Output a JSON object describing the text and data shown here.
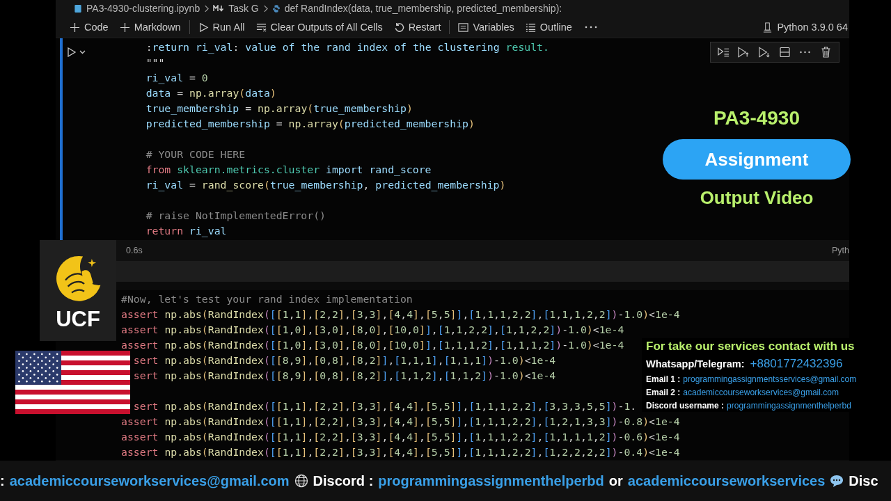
{
  "breadcrumb": [
    {
      "kind": "notebook",
      "text": "PA3-4930-clustering.ipynb"
    },
    {
      "kind": "markdown",
      "text": "Task G"
    },
    {
      "kind": "python",
      "text": "def RandIndex(data, true_membership, predicted_membership):"
    }
  ],
  "toolbar": [
    {
      "kind": "plus",
      "label": "Code"
    },
    {
      "kind": "plus",
      "label": "Markdown"
    },
    {
      "kind": "run",
      "label": "Run All"
    },
    {
      "kind": "clear",
      "label": "Clear Outputs of All Cells"
    },
    {
      "kind": "restart",
      "label": "Restart"
    },
    {
      "kind": "variables",
      "label": "Variables"
    },
    {
      "kind": "outline",
      "label": "Outline"
    }
  ],
  "kernel": "Python 3.9.0 64",
  "cells": [
    {
      "selected": true,
      "time": "0.6s",
      "language": "Pyth",
      "blocks": [
        [
          "    :return ri_val: value of the rand index of the clustering result.",
          "    \"\"\"",
          "    ri_val = 0",
          "    data = np.array(data)",
          "    true_membership = np.array(true_membership)",
          "    predicted_membership = np.array(predicted_membership)"
        ],
        [
          "    # YOUR CODE HERE",
          "    from sklearn.metrics.cluster import rand_score",
          "    ri_val = rand_score(true_membership, predicted_membership)"
        ],
        [
          "    # raise NotImplementedError()",
          "    return ri_val"
        ]
      ]
    },
    {
      "selected": false,
      "blocks": [
        [
          "#Now, let's test your rand index implementation",
          "assert np.abs(RandIndex([[1,1],[2,2],[3,3],[4,4],[5,5]],[1,1,1,2,2],[1,1,1,2,2])-1.0)<1e-4",
          "assert np.abs(RandIndex([[1,0],[3,0],[8,0],[10,0]],[1,1,2,2],[1,1,2,2])-1.0)<1e-4",
          "assert np.abs(RandIndex([[1,0],[3,0],[8,0],[10,0]],[1,1,1,2],[1,1,1,2])-1.0)<1e-4",
          "  sert np.abs(RandIndex([[8,9],[0,8],[8,2]],[1,1,1],[1,1,1])-1.0)<1e-4",
          "  sert np.abs(RandIndex([[8,9],[0,8],[8,2]],[1,1,2],[1,1,2])-1.0)<1e-4"
        ],
        [
          "  sert np.abs(RandIndex([[1,1],[2,2],[3,3],[4,4],[5,5]],[1,1,1,2,2],[3,3,3,5,5])-1.",
          "assert np.abs(RandIndex([[1,1],[2,2],[3,3],[4,4],[5,5]],[1,1,1,2,2],[1,2,1,3,3])-0.8)<1e-4",
          "assert np.abs(RandIndex([[1,1],[2,2],[3,3],[4,4],[5,5]],[1,1,1,2,2],[1,1,1,1,2])-0.6)<1e-4",
          "assert np.abs(RandIndex([[1,1],[2,2],[3,3],[4,4],[5,5]],[1,1,1,2,2],[1,2,2,2,2])-0.4)<1e-4"
        ]
      ]
    }
  ],
  "promo": {
    "title": "PA3-4930",
    "badge": "Assignment",
    "subtitle": "Output Video"
  },
  "logo": {
    "text": "UCF"
  },
  "contact": {
    "heading": "For  take our services contact with us",
    "rows": [
      {
        "kind": "phone",
        "label": "Whatsapp/Telegram:",
        "value": "+8801772432396"
      },
      {
        "kind": "email",
        "label": "Email 1 :",
        "value": "programmingassignmentsservices@gmail.com"
      },
      {
        "kind": "email",
        "label": "Email 2 :",
        "value": "academiccourseworkservices@gmail.com"
      },
      {
        "kind": "username",
        "label": "Discord username :",
        "value": "programmingassignmenthelperbd"
      }
    ]
  },
  "ticker": [
    {
      "kind": "plain",
      "label": ":",
      "link": "academiccourseworkservices@gmail.com"
    },
    {
      "kind": "globe",
      "label": "Discord  :",
      "link": "programmingassignmenthelperbd"
    },
    {
      "kind": "plain",
      "label": "or",
      "link": "academiccourseworkservices"
    },
    {
      "kind": "chat",
      "label": "Disc"
    }
  ]
}
